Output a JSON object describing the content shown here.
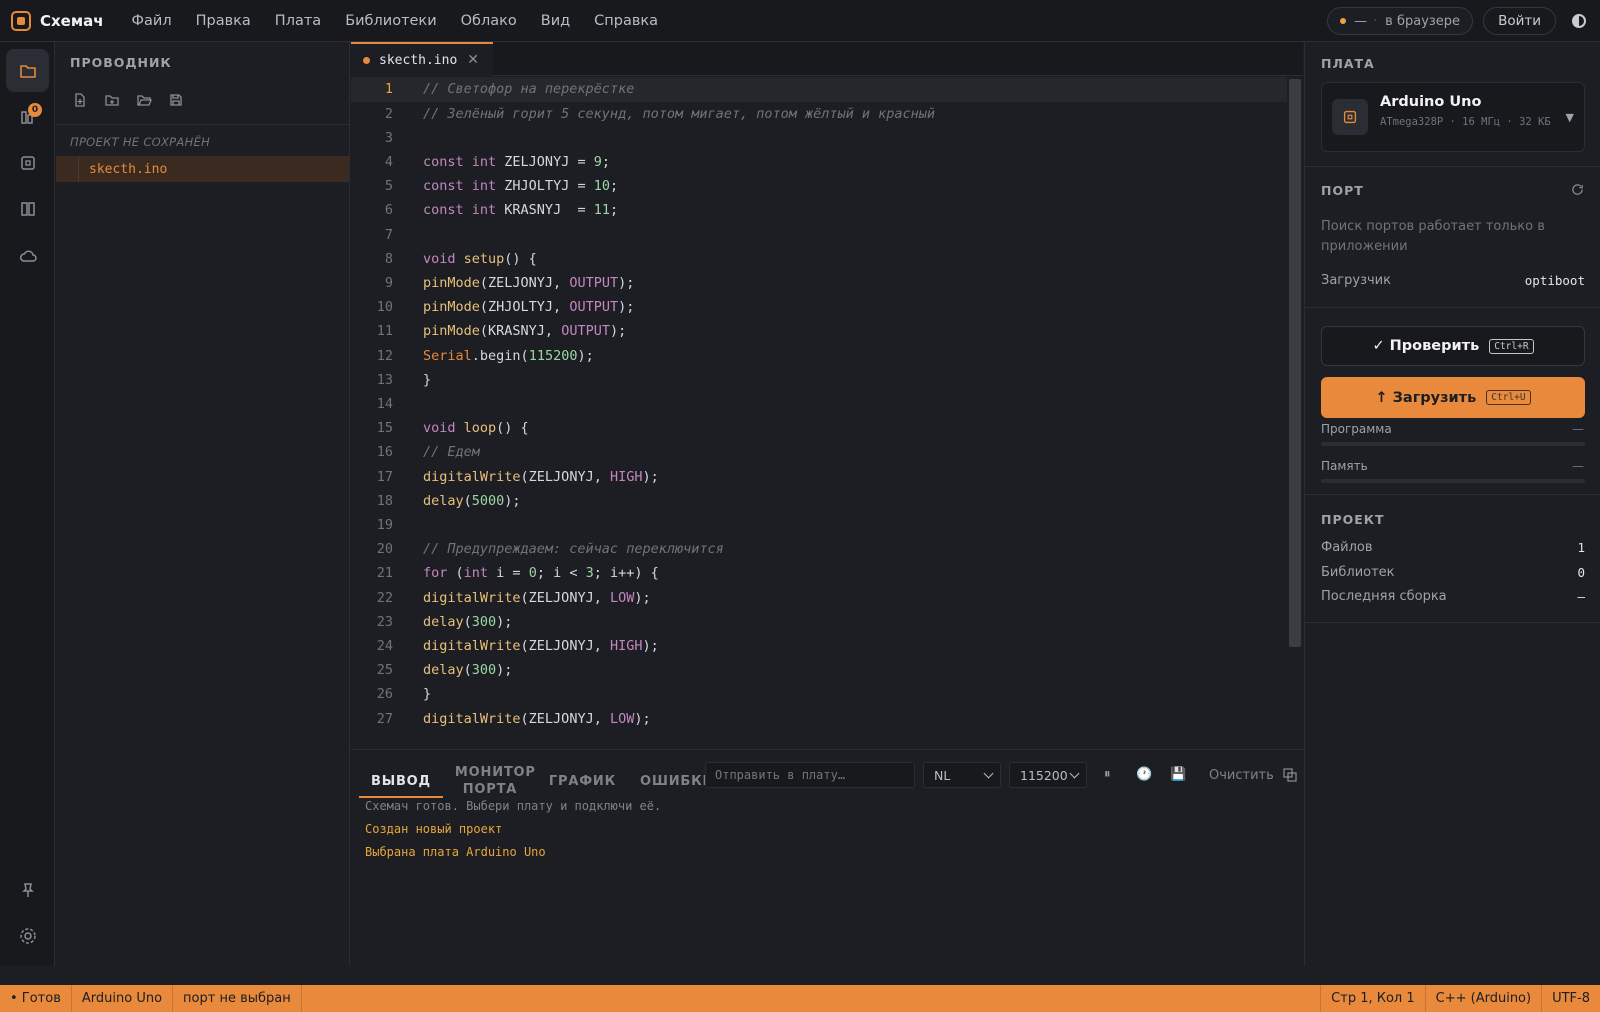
{
  "app": {
    "name": "Схемач"
  },
  "menu": [
    "Файл",
    "Правка",
    "Плата",
    "Библиотеки",
    "Облако",
    "Вид",
    "Справка"
  ],
  "topbar": {
    "status_dash": "—",
    "status_text": "в браузере",
    "login": "Войти"
  },
  "activity": {
    "libraries_badge": "0"
  },
  "explorer": {
    "title": "ПРОВОДНИК",
    "project_label": "ПРОЕКТ НЕ СОХРАНЁН",
    "files": [
      "skecth.ino"
    ]
  },
  "editor": {
    "tab_name": "skecth.ino",
    "lines": [
      [
        {
          "c": "c-com",
          "t": "// Светофор на перекрёстке"
        }
      ],
      [
        {
          "c": "c-com",
          "t": "// Зелёный горит 5 секунд, потом мигает, потом жёлтый и красный"
        }
      ],
      [],
      [
        {
          "c": "c-kw",
          "t": "const "
        },
        {
          "c": "c-ty",
          "t": "int "
        },
        {
          "c": "",
          "t": "ZELJONYJ = "
        },
        {
          "c": "c-num",
          "t": "9"
        },
        {
          "c": "",
          "t": ";"
        }
      ],
      [
        {
          "c": "c-kw",
          "t": "const "
        },
        {
          "c": "c-ty",
          "t": "int "
        },
        {
          "c": "",
          "t": "ZHJOLTYJ = "
        },
        {
          "c": "c-num",
          "t": "10"
        },
        {
          "c": "",
          "t": ";"
        }
      ],
      [
        {
          "c": "c-kw",
          "t": "const "
        },
        {
          "c": "c-ty",
          "t": "int "
        },
        {
          "c": "",
          "t": "KRASNYJ  = "
        },
        {
          "c": "c-num",
          "t": "11"
        },
        {
          "c": "",
          "t": ";"
        }
      ],
      [],
      [
        {
          "c": "c-ty",
          "t": "void "
        },
        {
          "c": "c-fn",
          "t": "setup"
        },
        {
          "c": "",
          "t": "() {"
        }
      ],
      [
        {
          "c": "c-fn",
          "t": "pinMode"
        },
        {
          "c": "",
          "t": "(ZELJONYJ, "
        },
        {
          "c": "c-const",
          "t": "OUTPUT"
        },
        {
          "c": "",
          "t": ");"
        }
      ],
      [
        {
          "c": "c-fn",
          "t": "pinMode"
        },
        {
          "c": "",
          "t": "(ZHJOLTYJ, "
        },
        {
          "c": "c-const",
          "t": "OUTPUT"
        },
        {
          "c": "",
          "t": ");"
        }
      ],
      [
        {
          "c": "c-fn",
          "t": "pinMode"
        },
        {
          "c": "",
          "t": "(KRASNYJ, "
        },
        {
          "c": "c-const",
          "t": "OUTPUT"
        },
        {
          "c": "",
          "t": ");"
        }
      ],
      [
        {
          "c": "c-cls",
          "t": "Serial"
        },
        {
          "c": "",
          "t": ".begin("
        },
        {
          "c": "c-num",
          "t": "115200"
        },
        {
          "c": "",
          "t": ");"
        }
      ],
      [
        {
          "c": "",
          "t": "}"
        }
      ],
      [],
      [
        {
          "c": "c-ty",
          "t": "void "
        },
        {
          "c": "c-fn",
          "t": "loop"
        },
        {
          "c": "",
          "t": "() {"
        }
      ],
      [
        {
          "c": "c-com",
          "t": "// Едем"
        }
      ],
      [
        {
          "c": "c-fn",
          "t": "digitalWrite"
        },
        {
          "c": "",
          "t": "(ZELJONYJ, "
        },
        {
          "c": "c-const",
          "t": "HIGH"
        },
        {
          "c": "",
          "t": ");"
        }
      ],
      [
        {
          "c": "c-fn",
          "t": "delay"
        },
        {
          "c": "",
          "t": "("
        },
        {
          "c": "c-num",
          "t": "5000"
        },
        {
          "c": "",
          "t": ");"
        }
      ],
      [],
      [
        {
          "c": "c-com",
          "t": "// Предупреждаем: сейчас переключится"
        }
      ],
      [
        {
          "c": "c-kw",
          "t": "for "
        },
        {
          "c": "",
          "t": "("
        },
        {
          "c": "c-ty",
          "t": "int "
        },
        {
          "c": "",
          "t": "i = "
        },
        {
          "c": "c-num",
          "t": "0"
        },
        {
          "c": "",
          "t": "; i < "
        },
        {
          "c": "c-num",
          "t": "3"
        },
        {
          "c": "",
          "t": "; i++) {"
        }
      ],
      [
        {
          "c": "c-fn",
          "t": "digitalWrite"
        },
        {
          "c": "",
          "t": "(ZELJONYJ, "
        },
        {
          "c": "c-const",
          "t": "LOW"
        },
        {
          "c": "",
          "t": ");"
        }
      ],
      [
        {
          "c": "c-fn",
          "t": "delay"
        },
        {
          "c": "",
          "t": "("
        },
        {
          "c": "c-num",
          "t": "300"
        },
        {
          "c": "",
          "t": ");"
        }
      ],
      [
        {
          "c": "c-fn",
          "t": "digitalWrite"
        },
        {
          "c": "",
          "t": "(ZELJONYJ, "
        },
        {
          "c": "c-const",
          "t": "HIGH"
        },
        {
          "c": "",
          "t": ");"
        }
      ],
      [
        {
          "c": "c-fn",
          "t": "delay"
        },
        {
          "c": "",
          "t": "("
        },
        {
          "c": "c-num",
          "t": "300"
        },
        {
          "c": "",
          "t": ");"
        }
      ],
      [
        {
          "c": "",
          "t": "}"
        }
      ],
      [
        {
          "c": "c-fn",
          "t": "digitalWrite"
        },
        {
          "c": "",
          "t": "(ZELJONYJ, "
        },
        {
          "c": "c-const",
          "t": "LOW"
        },
        {
          "c": "",
          "t": ");"
        }
      ]
    ]
  },
  "output_panel": {
    "tabs": [
      "ВЫВОД",
      "МОНИТОР ПОРТА",
      "ГРАФИК",
      "ОШИБКИ"
    ],
    "send_placeholder": "Отправить в плату…",
    "line_ending": "NL",
    "baud": "115200",
    "clear": "Очистить",
    "log": [
      {
        "text": "Схемач готов. Выбери плату и подключи её.",
        "color": "#7e828b"
      },
      {
        "text": "Создан новый проект",
        "color": "#e8a53b"
      },
      {
        "text": "Выбрана плата Arduino Uno",
        "color": "#e8a53b"
      }
    ]
  },
  "right_panel": {
    "board_title": "ПЛАТА",
    "board_name": "Arduino Uno",
    "board_spec": "ATmega328P · 16 МГц · 32 КБ",
    "port_title": "ПОРТ",
    "port_note": "Поиск портов работает только в приложении",
    "bootloader_label": "Загрузчик",
    "bootloader_value": "optiboot",
    "verify_label": "✓ Проверить",
    "verify_kbd": "Ctrl+R",
    "upload_label": "↑ Загрузить",
    "upload_kbd": "Ctrl+U",
    "program_label": "Программа",
    "program_value": "—",
    "memory_label": "Память",
    "memory_value": "—",
    "project_title": "ПРОЕКТ",
    "files_label": "Файлов",
    "files_value": "1",
    "libs_label": "Библиотек",
    "libs_value": "0",
    "build_label": "Последняя сборка",
    "build_value": "—"
  },
  "statusbar": {
    "ready": "• Готов",
    "board": "Arduino Uno",
    "port": "порт не выбран",
    "position": "Стр 1, Кол 1",
    "language": "C++ (Arduino)",
    "encoding": "UTF-8"
  },
  "colors": {
    "accent": "#e8893b",
    "bg": "#1c1e23",
    "bar": "#17191d"
  }
}
